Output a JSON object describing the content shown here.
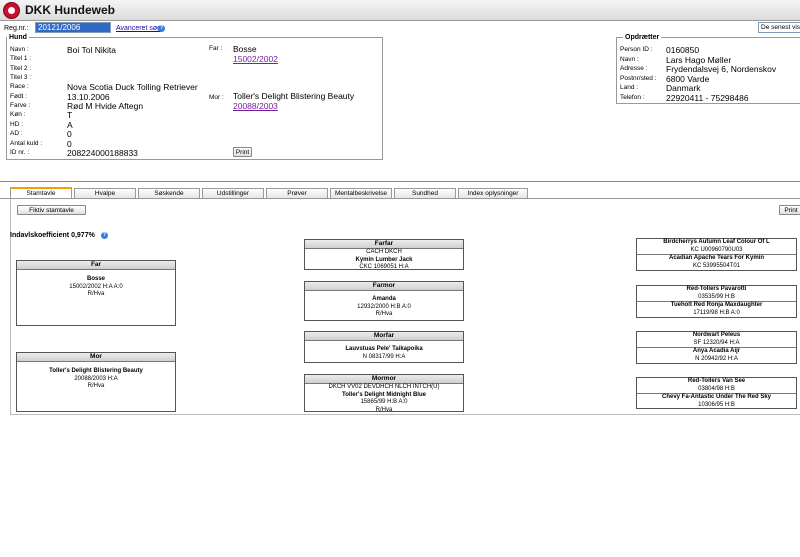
{
  "app": {
    "title": "DKK Hundeweb"
  },
  "search": {
    "label": "Reg.nr.:",
    "value": "20121/2006",
    "advanced_link": "Avanceret søg",
    "recent_select": "De senest viste"
  },
  "dog": {
    "legend": "Hund",
    "fields": [
      {
        "label": "Navn :",
        "value": "Boi Tol Nikita"
      },
      {
        "label": "Titel 1 :",
        "value": ""
      },
      {
        "label": "Titel 2 :",
        "value": ""
      },
      {
        "label": "Titel 3 :",
        "value": ""
      },
      {
        "label": "Race :",
        "value": "Nova Scotia Duck Tolling Retriever"
      },
      {
        "label": "Født :",
        "value": "13.10.2006"
      },
      {
        "label": "Farve :",
        "value": "Rød M Hvide Aftegn"
      },
      {
        "label": "Køn :",
        "value": "T"
      },
      {
        "label": "HD :",
        "value": "A"
      },
      {
        "label": "AD :",
        "value": "0"
      },
      {
        "label": "Antal kuld :",
        "value": "0"
      },
      {
        "label": "ID nr. :",
        "value": "208224000188833"
      }
    ],
    "father_label": "Far :",
    "father_name": "Bosse",
    "father_reg": "15002/2002",
    "mother_label": "Mor :",
    "mother_name": "Toller's Delight Blistering Beauty",
    "mother_reg": "20088/2003",
    "print_label": "Print"
  },
  "breeder": {
    "legend": "Opdrætter",
    "fields": [
      {
        "label": "Person ID :",
        "value": "0160850"
      },
      {
        "label": "Navn :",
        "value": "Lars Hago Møller"
      },
      {
        "label": "Adresse :",
        "value": "Frydendalsvej 6, Nordenskov"
      },
      {
        "label": "Postnr/sted :",
        "value": "6800 Varde"
      },
      {
        "label": "Land :",
        "value": "Danmark"
      },
      {
        "label": "Telefon :",
        "value": "22920411 - 75298486"
      }
    ]
  },
  "tabs": [
    "Stamtavle",
    "Hvalpe",
    "Søskende",
    "Udstillinger",
    "Prøver",
    "Mentalbeskrivelse",
    "Sundhed",
    "Index oplysninger"
  ],
  "pedigree": {
    "fictive_button": "Fiktiv stamtavle",
    "print_label": "Print",
    "inbreeding": "Indavlskoefficient 0,977%",
    "parents": [
      {
        "header": "Far",
        "name": "Bosse",
        "info": "15002/2002    H:A    A:0",
        "color": "R/Hva"
      },
      {
        "header": "Mor",
        "name": "Toller's Delight Blistering Beauty",
        "info": "20088/2003    H:A",
        "color": "R/Hva"
      }
    ],
    "grandparents": [
      {
        "header": "Farfar",
        "title": "CACH DKCH",
        "name": "Kymin Lumber Jack",
        "info": "CKC 1069051    H:A",
        "color": ""
      },
      {
        "header": "Farmor",
        "title": "",
        "name": "Amanda",
        "info": "12932/2000    H:B    A:0",
        "color": "R/Hva"
      },
      {
        "header": "Morfar",
        "title": "",
        "name": "Lauvstuas Pele' Taikapoika",
        "info": "N 08317/99    H:A",
        "color": ""
      },
      {
        "header": "Mormor",
        "title": "DKCH VV02 DEVDHCH NLCH INTCH(U)",
        "name": "Toller's Delight Midnight Blue",
        "info": "15865/99    H:B    A:0",
        "color": "R/Hva"
      }
    ],
    "great_grandparents": [
      {
        "a_name": "Birdcherrys Autumn Leaf Colour Of L",
        "a_info": "KC U00960790U03",
        "b_name": "Acadian Apache Tears For Kymin",
        "b_info": "KC 53995504T01"
      },
      {
        "a_name": "Red-Tollers Pavarotti",
        "a_info": "03535/99    H:B",
        "b_name": "Tueholt Red Ronja Maxdaughter",
        "b_info": "17119/98    H:B    A:0"
      },
      {
        "a_name": "Nordwart Peleus",
        "a_info": "SF 12320/94    H:A",
        "b_name": "Anya Acadia Aijr",
        "b_info": "N 20942/92    H:A"
      },
      {
        "a_name": "Red-Tollers Van See",
        "a_info": "03804/98    H:B",
        "b_name": "Chevy Fa-Antastic Under The Red Sky",
        "b_info": "10306/95    H:B"
      }
    ]
  }
}
